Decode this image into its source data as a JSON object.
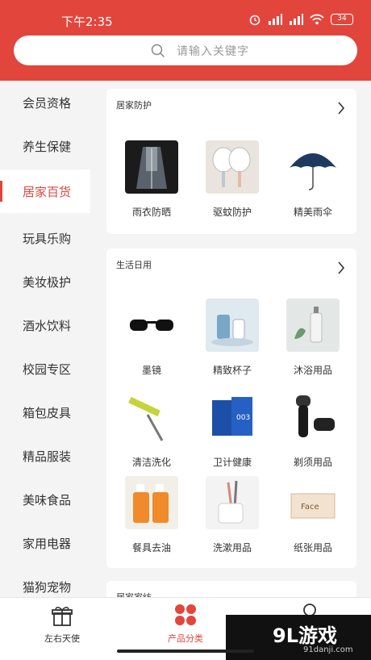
{
  "status_bar": {
    "time": "下午2:35",
    "battery": "34"
  },
  "search": {
    "placeholder": "请输入关键字"
  },
  "sidebar": {
    "items": [
      {
        "label": "会员资格"
      },
      {
        "label": "养生保健"
      },
      {
        "label": "居家百货",
        "active": true
      },
      {
        "label": "玩具乐购"
      },
      {
        "label": "美妆极护"
      },
      {
        "label": "酒水饮料"
      },
      {
        "label": "校园专区"
      },
      {
        "label": "箱包皮具"
      },
      {
        "label": "精品服装"
      },
      {
        "label": "美味食品"
      },
      {
        "label": "家用电器"
      },
      {
        "label": "猫狗宠物"
      }
    ]
  },
  "sections": [
    {
      "title": "居家防护",
      "items": [
        {
          "label": "雨衣防晒"
        },
        {
          "label": "驱蚊防护"
        },
        {
          "label": "精美雨伞"
        }
      ]
    },
    {
      "title": "生活日用",
      "items": [
        {
          "label": "墨镜"
        },
        {
          "label": "精致杯子"
        },
        {
          "label": "沐浴用品"
        },
        {
          "label": "清洁洗化"
        },
        {
          "label": "卫计健康"
        },
        {
          "label": "剃须用品"
        },
        {
          "label": "餐具去油"
        },
        {
          "label": "洗漱用品"
        },
        {
          "label": "纸张用品"
        }
      ]
    },
    {
      "title": "居家家纺"
    }
  ],
  "tabbar": {
    "tabs": [
      {
        "label": "左右天使"
      },
      {
        "label": "产品分类",
        "active": true
      }
    ]
  },
  "watermark": {
    "brand": "9L游戏",
    "url": "91danji.com"
  },
  "colors": {
    "accent": "#e2453c"
  }
}
